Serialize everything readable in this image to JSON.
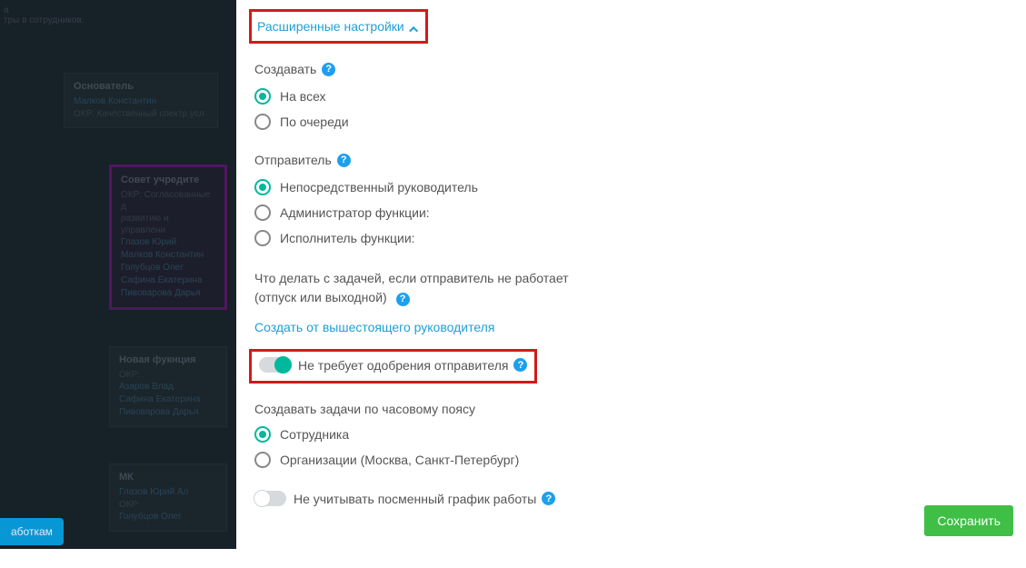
{
  "backdrop": {
    "topline1": "а",
    "topline2": "тры в сотрудников.",
    "founder": {
      "title": "Основатель",
      "name": "Малков Константин",
      "okr": "ОКР: Качественный спектр усл"
    },
    "board": {
      "title": "Совет учредите",
      "okr": "ОКР: Согласованные д\nразвитию и управлени",
      "names": [
        "Глазов Юрий",
        "Малков Константин",
        "Голубцов Олег",
        "Сафина Екатерина",
        "Пивоварова Дарья"
      ]
    },
    "func": {
      "title": "Новая фукнция",
      "okr": "ОКР:",
      "names": [
        "Азаров Влад",
        "Сафина Екатерина",
        "Пивоварова Дарья"
      ]
    },
    "mk": {
      "title": "МК",
      "name": "Глазов Юрий Ал",
      "okr": "ОКР:",
      "sub": "Голубцов Олег"
    },
    "bottom_button": "аботкам"
  },
  "panel": {
    "advanced": "Расширенные настройки",
    "create": {
      "title": "Создавать",
      "opt_all": "На всех",
      "opt_queue": "По очереди"
    },
    "sender": {
      "title": "Отправитель",
      "opt_direct": "Непосредственный руководитель",
      "opt_admin": "Администратор функции:",
      "opt_exec": "Исполнитель функции:"
    },
    "fallback": {
      "desc": "Что делать с задачей, если отправитель не работает (отпуск или выходной)",
      "action_link": "Создать от вышестоящего руководителя"
    },
    "no_approval": "Не требует одобрения отправителя",
    "tz": {
      "title": "Создавать задачи по часовому поясу",
      "opt_employee": "Сотрудника",
      "opt_org": "Организации (Москва, Санкт-Петербург)"
    },
    "shift": "Не учитывать посменный график работы",
    "save": "Сохранить"
  },
  "help_glyph": "?"
}
